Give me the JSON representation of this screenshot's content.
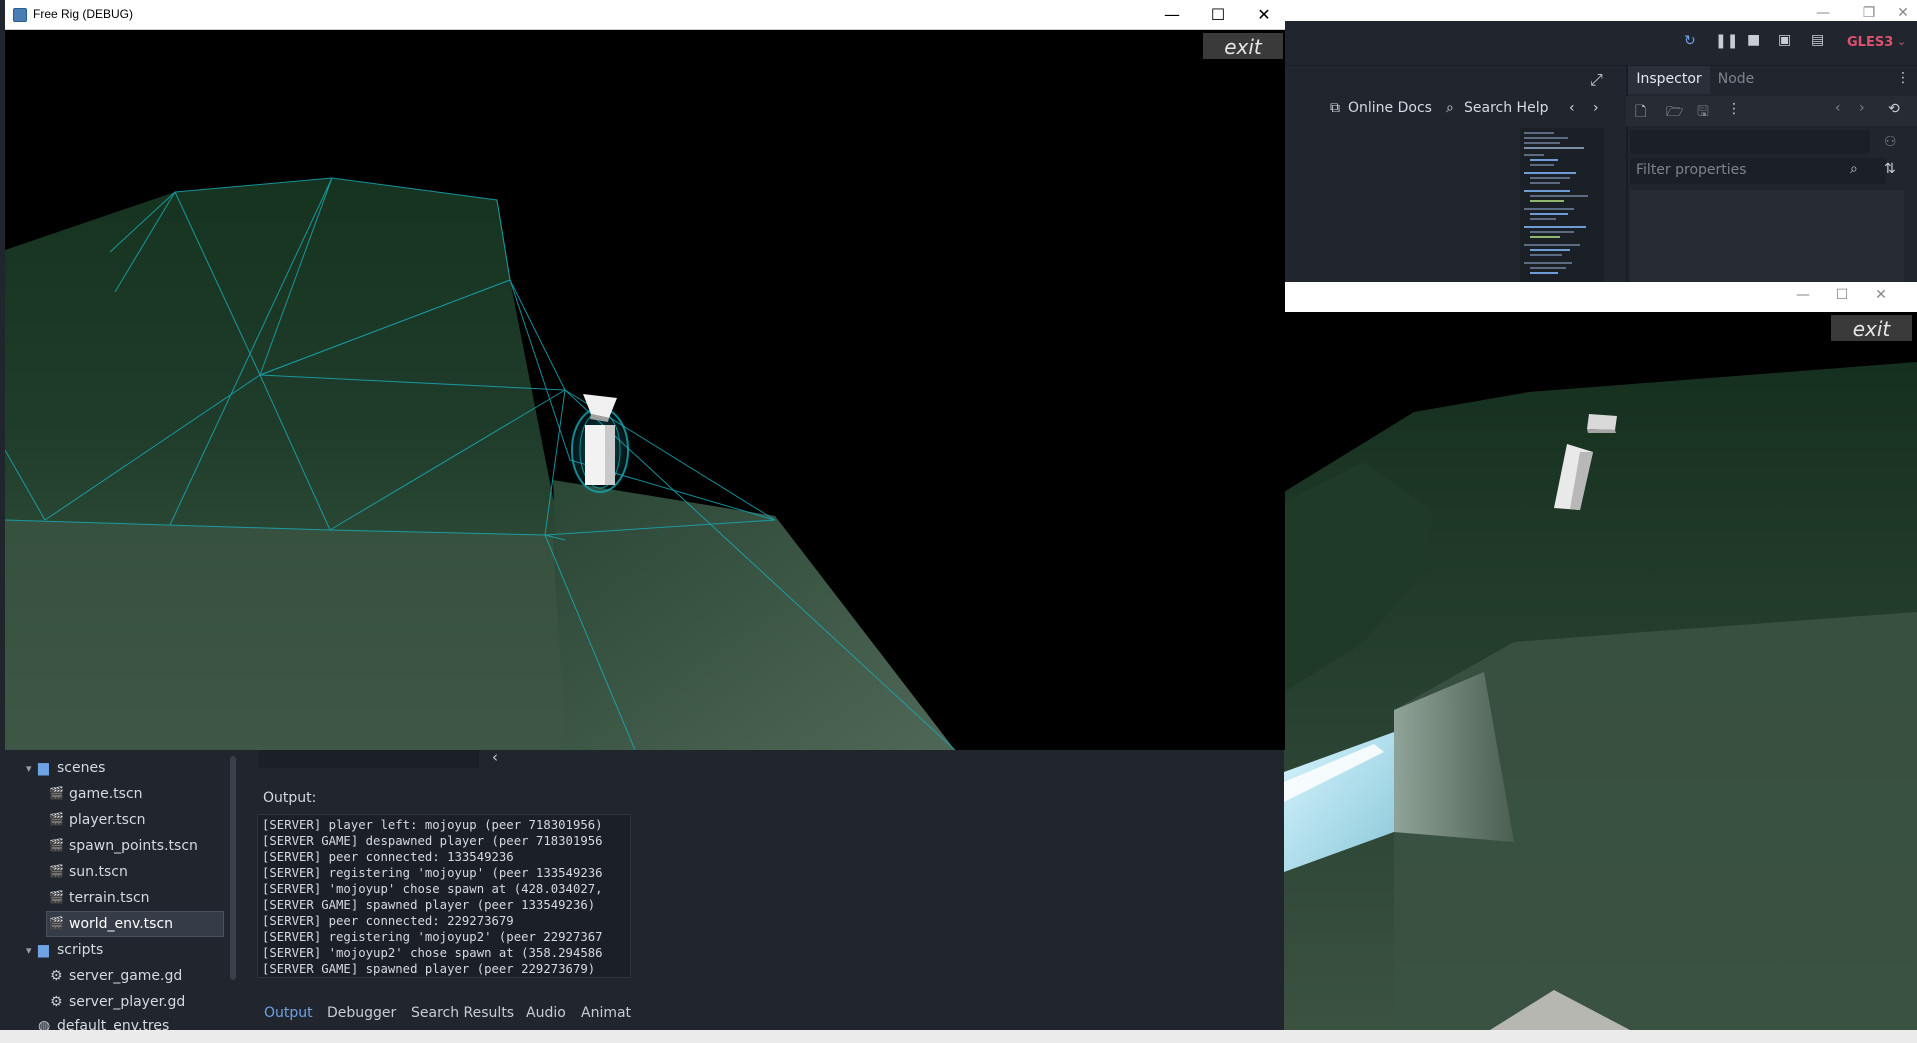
{
  "main_window": {
    "title": "Free Rig (DEBUG)",
    "exit_label": "exit",
    "minimize_glyph": "—",
    "maximize_glyph": "☐",
    "close_glyph": "✕"
  },
  "second_window": {
    "exit_label": "exit",
    "minimize_glyph": "—",
    "maximize_glyph": "☐",
    "close_glyph": "✕"
  },
  "editor": {
    "renderer_label": "GLES3",
    "help_bar": {
      "online_docs": "Online Docs",
      "search_help": "Search Help"
    },
    "inspector": {
      "tabs": [
        "Inspector",
        "Node"
      ],
      "filter_placeholder": "Filter properties"
    }
  },
  "filesystem": {
    "items": [
      {
        "label": "scenes",
        "kind": "folder"
      },
      {
        "label": "game.tscn",
        "kind": "scene"
      },
      {
        "label": "player.tscn",
        "kind": "scene"
      },
      {
        "label": "spawn_points.tscn",
        "kind": "scene"
      },
      {
        "label": "sun.tscn",
        "kind": "scene"
      },
      {
        "label": "terrain.tscn",
        "kind": "scene"
      },
      {
        "label": "world_env.tscn",
        "kind": "scene",
        "selected": true
      },
      {
        "label": "scripts",
        "kind": "folder"
      },
      {
        "label": "server_game.gd",
        "kind": "script"
      },
      {
        "label": "server_player.gd",
        "kind": "script"
      },
      {
        "label": "default_env.tres",
        "kind": "resource"
      }
    ]
  },
  "output": {
    "label": "Output:",
    "lines": [
      "[SERVER] player left: mojoyup (peer 718301956)",
      "[SERVER GAME] despawned player (peer 718301956",
      "[SERVER] peer connected: 133549236",
      "[SERVER] registering 'mojoyup' (peer 133549236",
      "[SERVER] 'mojoyup' chose spawn at (428.034027,",
      "[SERVER GAME] spawned player (peer 133549236)",
      "[SERVER] peer connected: 229273679",
      "[SERVER] registering 'mojoyup2' (peer 22927367",
      "[SERVER] 'mojoyup2' chose spawn at (358.294586",
      "[SERVER GAME] spawned player (peer 229273679)"
    ],
    "tabs": [
      "Output",
      "Debugger",
      "Search Results",
      "Audio",
      "Animat"
    ]
  },
  "colors": {
    "editor_bg": "#20252e",
    "accent": "#6ea3e6",
    "renderer_red": "#e0506f",
    "terrain_green": "#1f3d2a",
    "wire_cyan": "#19a8b4"
  }
}
